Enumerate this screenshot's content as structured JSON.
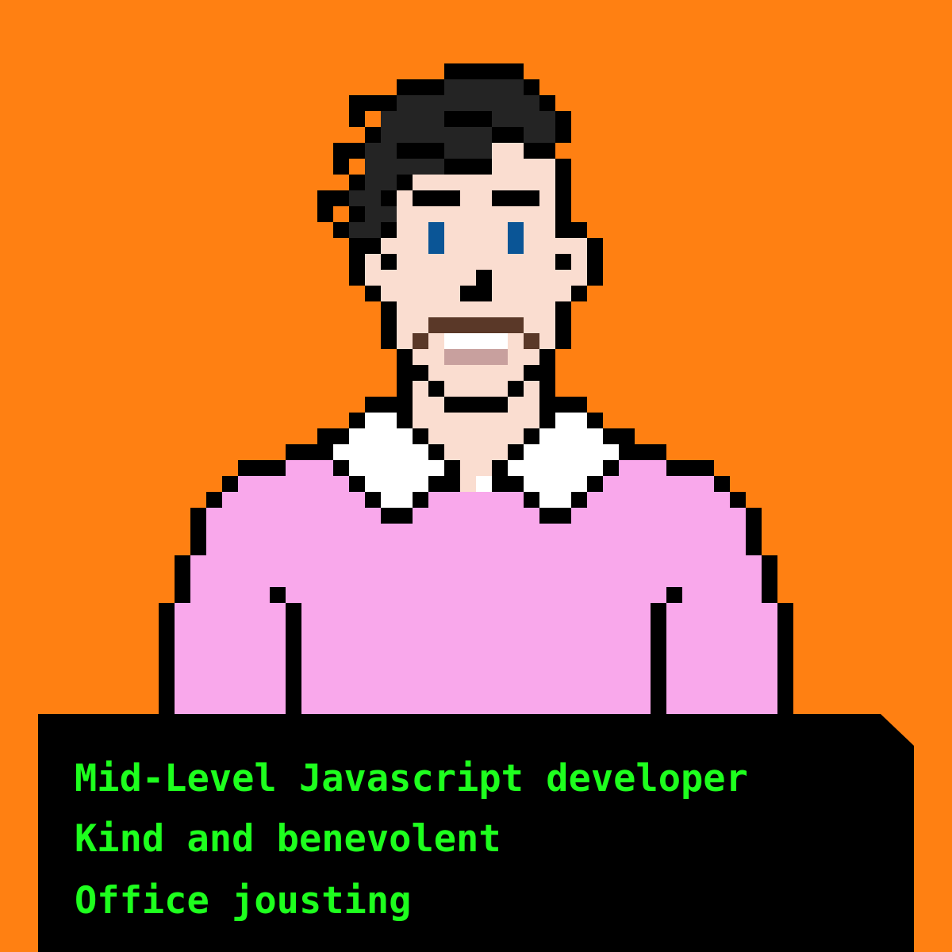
{
  "colors": {
    "background": "#FF8012",
    "outline": "#000000",
    "hair": "#242424",
    "skin": "#FADDD0",
    "eyes": "#0A5596",
    "mustache": "#5A3828",
    "teeth": "#FFFFFF",
    "gums": "#C8A09E",
    "collar": "#FFFFFF",
    "sweater": "#F9A8EB",
    "panel": "#000000",
    "trait_text": "#1EFF1E"
  },
  "traits": [
    "Mid-Level Javascript developer",
    "Kind and benevolent",
    "Office jousting"
  ]
}
